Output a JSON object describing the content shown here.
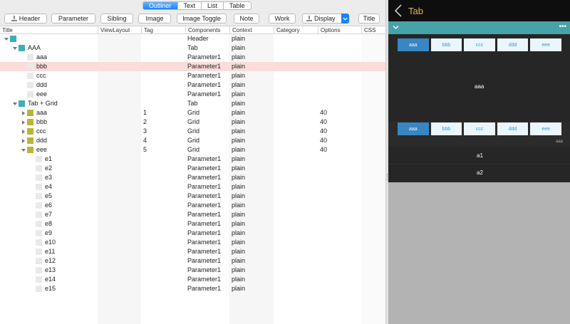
{
  "view_tabs": [
    "Outliner",
    "Text",
    "List",
    "Table"
  ],
  "toolbar": {
    "header": "Header",
    "parameter": "Parameter",
    "sibling": "Sibling",
    "image": "Image",
    "image_toggle": "Image Toggle",
    "note": "Note",
    "work": "Work",
    "display": "Display",
    "title": "Title"
  },
  "columns": [
    "Title",
    "ViewLayout",
    "Tag",
    "Components",
    "Context",
    "Category",
    "Options",
    "CSS"
  ],
  "rows": [
    {
      "title": "",
      "tag": "",
      "components": "Header",
      "context": "plain",
      "options": ""
    },
    {
      "title": "AAA",
      "tag": "",
      "components": "Tab",
      "context": "plain",
      "options": ""
    },
    {
      "title": "aaa",
      "tag": "",
      "components": "Parameter1",
      "context": "plain",
      "options": ""
    },
    {
      "title": "bbb",
      "tag": "",
      "components": "Parameter1",
      "context": "plain",
      "options": ""
    },
    {
      "title": "ccc",
      "tag": "",
      "components": "Parameter1",
      "context": "plain",
      "options": ""
    },
    {
      "title": "ddd",
      "tag": "",
      "components": "Parameter1",
      "context": "plain",
      "options": ""
    },
    {
      "title": "eee",
      "tag": "",
      "components": "Parameter1",
      "context": "plain",
      "options": ""
    },
    {
      "title": "Tab + Grid",
      "tag": "",
      "components": "Tab",
      "context": "plain",
      "options": ""
    },
    {
      "title": "aaa",
      "tag": "1",
      "components": "Grid",
      "context": "plain",
      "options": "40"
    },
    {
      "title": "bbb",
      "tag": "2",
      "components": "Grid",
      "context": "plain",
      "options": "40"
    },
    {
      "title": "ccc",
      "tag": "3",
      "components": "Grid",
      "context": "plain",
      "options": "40"
    },
    {
      "title": "ddd",
      "tag": "4",
      "components": "Grid",
      "context": "plain",
      "options": "40"
    },
    {
      "title": "eee",
      "tag": "5",
      "components": "Grid",
      "context": "plain",
      "options": "40"
    },
    {
      "title": "e1",
      "tag": "",
      "components": "Parameter1",
      "context": "plain",
      "options": ""
    },
    {
      "title": "e2",
      "tag": "",
      "components": "Parameter1",
      "context": "plain",
      "options": ""
    },
    {
      "title": "e3",
      "tag": "",
      "components": "Parameter1",
      "context": "plain",
      "options": ""
    },
    {
      "title": "e4",
      "tag": "",
      "components": "Parameter1",
      "context": "plain",
      "options": ""
    },
    {
      "title": "e5",
      "tag": "",
      "components": "Parameter1",
      "context": "plain",
      "options": ""
    },
    {
      "title": "e6",
      "tag": "",
      "components": "Parameter1",
      "context": "plain",
      "options": ""
    },
    {
      "title": "e7",
      "tag": "",
      "components": "Parameter1",
      "context": "plain",
      "options": ""
    },
    {
      "title": "e8",
      "tag": "",
      "components": "Parameter1",
      "context": "plain",
      "options": ""
    },
    {
      "title": "e9",
      "tag": "",
      "components": "Parameter1",
      "context": "plain",
      "options": ""
    },
    {
      "title": "e10",
      "tag": "",
      "components": "Parameter1",
      "context": "plain",
      "options": ""
    },
    {
      "title": "e11",
      "tag": "",
      "components": "Parameter1",
      "context": "plain",
      "options": ""
    },
    {
      "title": "e12",
      "tag": "",
      "components": "Parameter1",
      "context": "plain",
      "options": ""
    },
    {
      "title": "e13",
      "tag": "",
      "components": "Parameter1",
      "context": "plain",
      "options": ""
    },
    {
      "title": "e14",
      "tag": "",
      "components": "Parameter1",
      "context": "plain",
      "options": ""
    },
    {
      "title": "e15",
      "tag": "",
      "components": "Parameter1",
      "context": "plain",
      "options": ""
    }
  ],
  "preview": {
    "title": "Tab",
    "tabs": [
      "aaa",
      "bbb",
      "ccc",
      "ddd",
      "eee"
    ],
    "content_aaa": "aaa",
    "small_label": "aaa",
    "list_a1": "a1",
    "list_a2": "a2"
  },
  "colors": {
    "accent": "#1a82fb",
    "selection": "#fadcd9",
    "teal_icon": "#3bb0b5",
    "olive_icon": "#b8b53a",
    "preview_title": "#e0b84a",
    "preview_bar": "#48a3a8"
  }
}
